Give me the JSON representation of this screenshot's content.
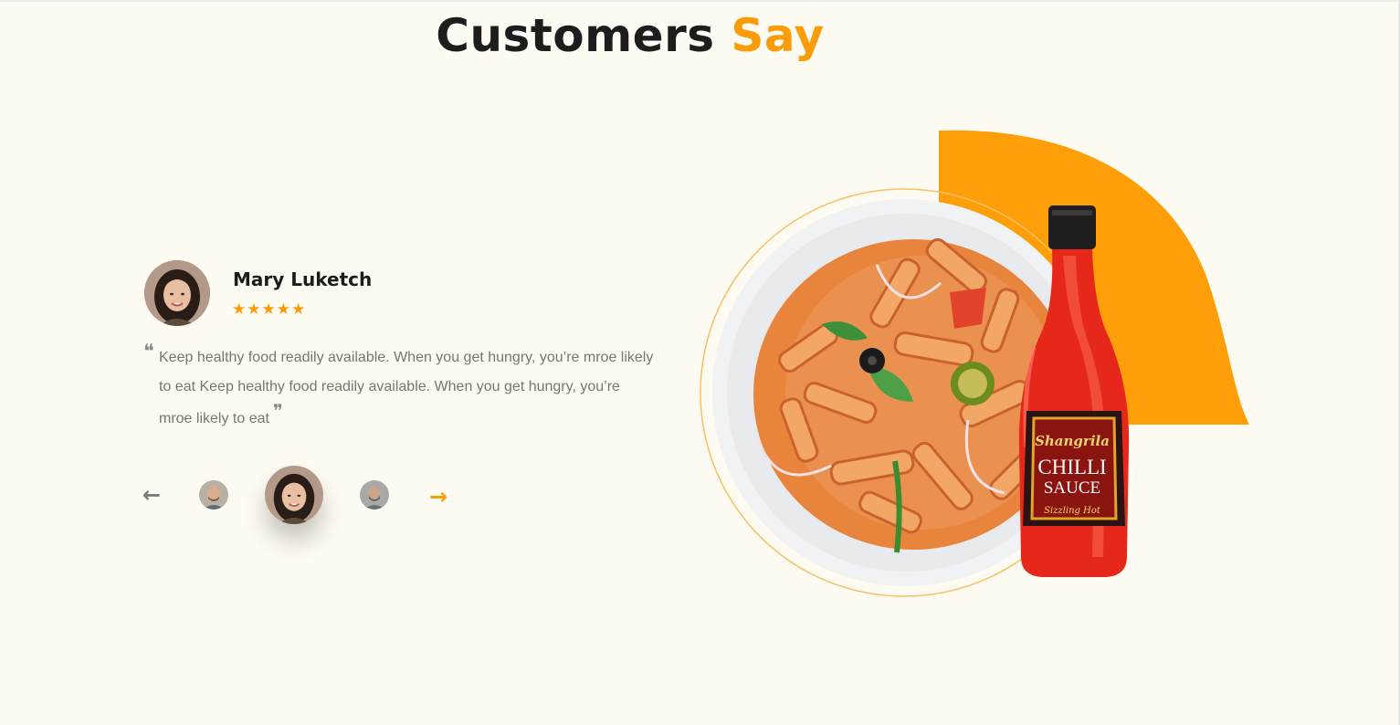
{
  "section": {
    "title_main": "Customers",
    "title_accent": "Say"
  },
  "review": {
    "name": "Mary Luketch",
    "rating": 5,
    "stars": [
      "★",
      "★",
      "★",
      "★",
      "★"
    ],
    "quote_open": "❝",
    "quote_close": "❞",
    "text": "Keep healthy food readily available. When you get hungry, you’re mroe likely to eat  Keep healthy food readily available. When you get hungry, you’re mroe likely to eat"
  },
  "carousel": {
    "prev_icon": "arrow-left-icon",
    "next_icon": "arrow-right-icon",
    "prev_glyph": "←",
    "next_glyph": "→",
    "active_index": 1
  },
  "product": {
    "brand": "Shangrila",
    "name_line1": "CHILLI",
    "name_line2": "SAUCE",
    "tagline": "Sizzling Hot"
  },
  "colors": {
    "accent": "#f99c08",
    "background": "#fefbf3",
    "heading": "#1d1d1d",
    "body_text": "#767676"
  }
}
